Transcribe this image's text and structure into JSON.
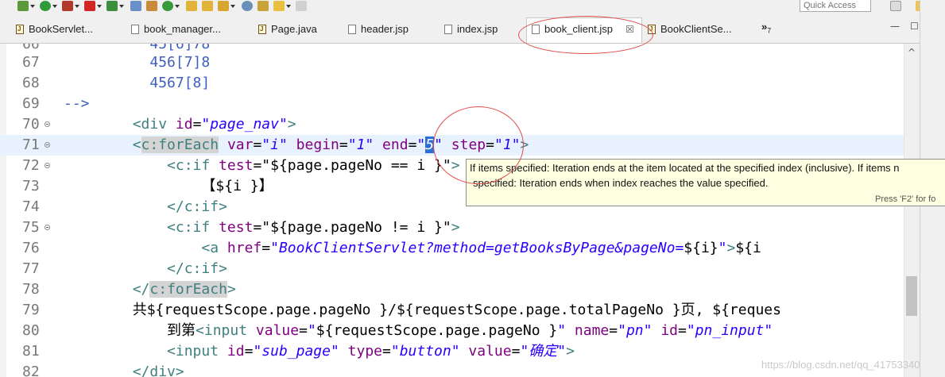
{
  "toolbar": {
    "quick_access_placeholder": "Quick Access"
  },
  "tabs": [
    {
      "label": "BookServlet...",
      "icon": "java-file-icon"
    },
    {
      "label": "book_manager...",
      "icon": "jsp-file-icon"
    },
    {
      "label": "Page.java",
      "icon": "java-file-icon"
    },
    {
      "label": "header.jsp",
      "icon": "jsp-file-icon"
    },
    {
      "label": "index.jsp",
      "icon": "jsp-file-icon"
    },
    {
      "label": "book_client.jsp",
      "icon": "jsp-file-icon",
      "active": true,
      "close": "☒"
    },
    {
      "label": "BookClientSe...",
      "icon": "java-file-icon"
    }
  ],
  "tab_overflow": {
    "label": "»",
    "count": "7"
  },
  "window_controls": {
    "minimize": "—",
    "maximize": "☐"
  },
  "editor": {
    "lines": [
      {
        "num": "66",
        "code": "          45[6]78"
      },
      {
        "num": "67",
        "code": "          456[7]8"
      },
      {
        "num": "68",
        "code": "          4567[8]"
      },
      {
        "num": "69",
        "code": "-->"
      },
      {
        "num": "70",
        "code": "        <div id=\"page_nav\">"
      },
      {
        "num": "71",
        "code": "        <c:forEach var=\"i\" begin=\"1\" end=\"5\" step=\"1\">"
      },
      {
        "num": "72",
        "code": "            <c:if test=\"${page.pageNo == i }\">"
      },
      {
        "num": "73",
        "code": "                【${i }】"
      },
      {
        "num": "74",
        "code": "            </c:if>"
      },
      {
        "num": "75",
        "code": "            <c:if test=\"${page.pageNo != i }\">"
      },
      {
        "num": "76",
        "code": "                <a href=\"BookClientServlet?method=getBooksByPage&pageNo=${i}\">${i"
      },
      {
        "num": "77",
        "code": "            </c:if>"
      },
      {
        "num": "78",
        "code": "        </c:forEach>"
      },
      {
        "num": "79",
        "code": "        共${requestScope.page.pageNo }/${requestScope.page.totalPageNo }页, ${reques"
      },
      {
        "num": "80",
        "code": "            到第<input value=\"${requestScope.page.pageNo }\" name=\"pn\" id=\"pn_input\""
      },
      {
        "num": "81",
        "code": "            <input id=\"sub_page\" type=\"button\" value=\"确定\">"
      },
      {
        "num": "82",
        "code": "        </div>"
      }
    ]
  },
  "tooltip": {
    "line1": "If items specified: Iteration ends at the item located at the specified index (inclusive). If items n",
    "line2": "specified: Iteration ends when index reaches the value specified.",
    "hint": "Press 'F2' for fo"
  },
  "watermark": "https://blog.csdn.net/qq_41753340",
  "colors": {
    "tag": "#3f7f7f",
    "attribute": "#7f007f",
    "value": "#2a00ff",
    "current_line": "#e8f2fe",
    "tooltip_bg": "#ffffe1",
    "annotation_ring": "#e24b4b"
  }
}
